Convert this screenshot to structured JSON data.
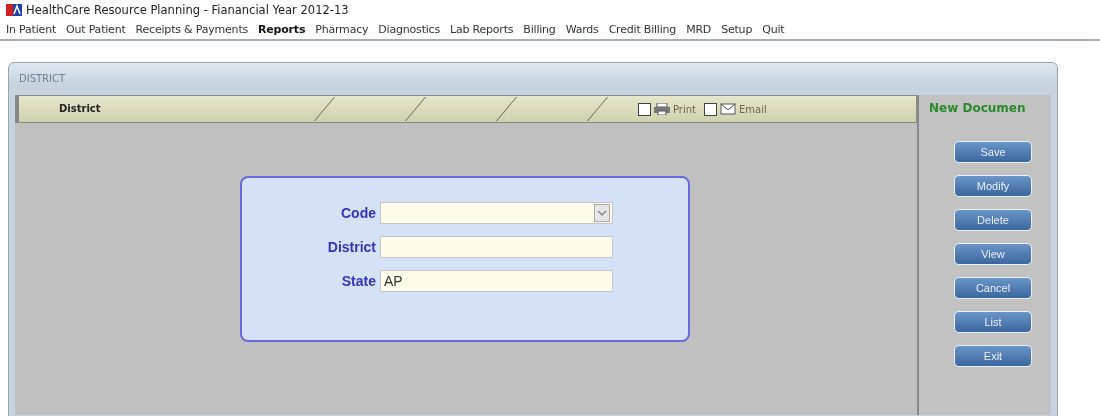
{
  "window": {
    "title": "HealthCare Resource Planning - Fianancial Year 2012-13"
  },
  "menu": [
    {
      "label": "In Patient",
      "selected": false
    },
    {
      "label": "Out Patient",
      "selected": false
    },
    {
      "label": "Receipts & Payments",
      "selected": false
    },
    {
      "label": "Reports",
      "selected": true
    },
    {
      "label": "Pharmacy",
      "selected": false
    },
    {
      "label": "Diagnostics",
      "selected": false
    },
    {
      "label": "Lab Reports",
      "selected": false
    },
    {
      "label": "Billing",
      "selected": false
    },
    {
      "label": "Wards",
      "selected": false
    },
    {
      "label": "Credit Billing",
      "selected": false
    },
    {
      "label": "MRD",
      "selected": false
    },
    {
      "label": "Setup",
      "selected": false
    },
    {
      "label": "Quit",
      "selected": false
    }
  ],
  "form": {
    "caption": "DISTRICT",
    "tab": "District",
    "options": [
      {
        "label": "Print",
        "checked": false
      },
      {
        "label": "Email",
        "checked": false
      }
    ],
    "mode": "New Documen",
    "fields": [
      {
        "label": "Code",
        "kind": "dropdown"
      },
      {
        "label": "District",
        "kind": "text"
      },
      {
        "label": "State",
        "kind": "text",
        "value": "AP"
      }
    ],
    "buttons": [
      "Save",
      "Modify",
      "Delete",
      "View",
      "Cancel",
      "List",
      "Exit"
    ]
  }
}
